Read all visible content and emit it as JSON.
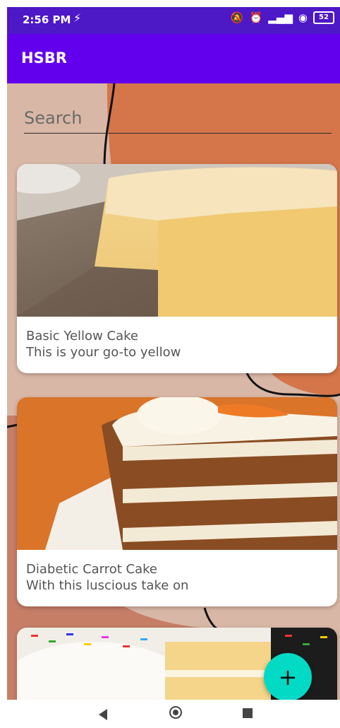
{
  "status_bar": {
    "time": "2:56 PM",
    "battery": "52"
  },
  "app_bar": {
    "title": "HSBR"
  },
  "search": {
    "placeholder": "Search"
  },
  "recipes": [
    {
      "title": "Basic Yellow Cake",
      "description": "This is your go-to yellow"
    },
    {
      "title": "Diabetic Carrot Cake",
      "description": "With this luscious take on"
    }
  ],
  "fab": {
    "label": "+"
  },
  "colors": {
    "status_bar": "#4d18c6",
    "app_bar": "#6200ee",
    "fab": "#03dac5",
    "background": "#d9b7a6"
  }
}
